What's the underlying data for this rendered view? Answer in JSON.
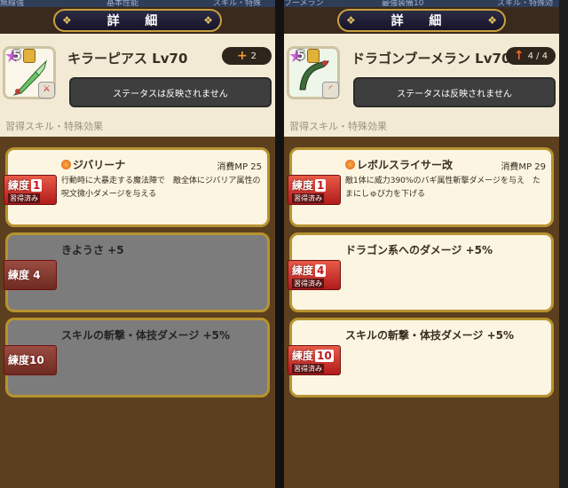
{
  "colors": {
    "accent_gold": "#b7932f",
    "mastery_red": "#c0171a",
    "panel_brown": "#5b3f1e"
  },
  "left": {
    "header": {
      "tab_left": "無線強",
      "tab_mid": "基本性能",
      "tab_right": "スキル・特殊"
    },
    "title": "詳 細",
    "weapon": {
      "stars": "5",
      "name": "キラーピアス Lv70",
      "icon": "dagger-icon",
      "type_icon": "dagger-type-icon"
    },
    "badge": {
      "icon": "+",
      "text": "2"
    },
    "status_text": "ステータスは反映されません",
    "section_label": "習得スキル・特殊効果",
    "skills": [
      {
        "mastery_label": "練度",
        "mastery_num": "1",
        "learned_label": "習得済み",
        "name": "ジバリーナ",
        "has_icon": true,
        "mp": "消費MP 25",
        "desc": "行動時に大暴走する魔法陣で　敵全体にジバリア属性の　呪文微小ダメージを与える",
        "learned": true
      },
      {
        "mastery_label": "練度",
        "mastery_num": "4",
        "learned_label": "",
        "name": "きようさ +5",
        "has_icon": false,
        "mp": "",
        "desc": "",
        "learned": false
      },
      {
        "mastery_label": "練度",
        "mastery_num": "10",
        "learned_label": "",
        "name": "スキルの斬撃・体技ダメージ +5%",
        "has_icon": false,
        "mp": "",
        "desc": "",
        "learned": false
      }
    ]
  },
  "right": {
    "header": {
      "tab_left": "ブーメラン",
      "tab_mid": "最強装備10",
      "tab_right": "スキル・特殊効"
    },
    "title": "詳 細",
    "weapon": {
      "stars": "5",
      "name": "ドラゴンブーメラン Lv70",
      "icon": "boomerang-icon",
      "type_icon": "boomerang-type-icon"
    },
    "badge": {
      "icon": "↑",
      "text": "4 / 4"
    },
    "status_text": "ステータスは反映されません",
    "section_label": "習得スキル・特殊効果",
    "skills": [
      {
        "mastery_label": "練度",
        "mastery_num": "1",
        "learned_label": "習得済み",
        "name": "レボルスライサー改",
        "has_icon": true,
        "mp": "消費MP 29",
        "desc": "敵1体に威力390%のバギ属性斬撃ダメージを与え　たまにしゅび力を下げる",
        "learned": true
      },
      {
        "mastery_label": "練度",
        "mastery_num": "4",
        "learned_label": "習得済み",
        "name": "ドラゴン系へのダメージ +5%",
        "has_icon": false,
        "mp": "",
        "desc": "",
        "learned": true
      },
      {
        "mastery_label": "練度",
        "mastery_num": "10",
        "learned_label": "習得済み",
        "name": "スキルの斬撃・体技ダメージ +5%",
        "has_icon": false,
        "mp": "",
        "desc": "",
        "learned": true
      }
    ]
  }
}
